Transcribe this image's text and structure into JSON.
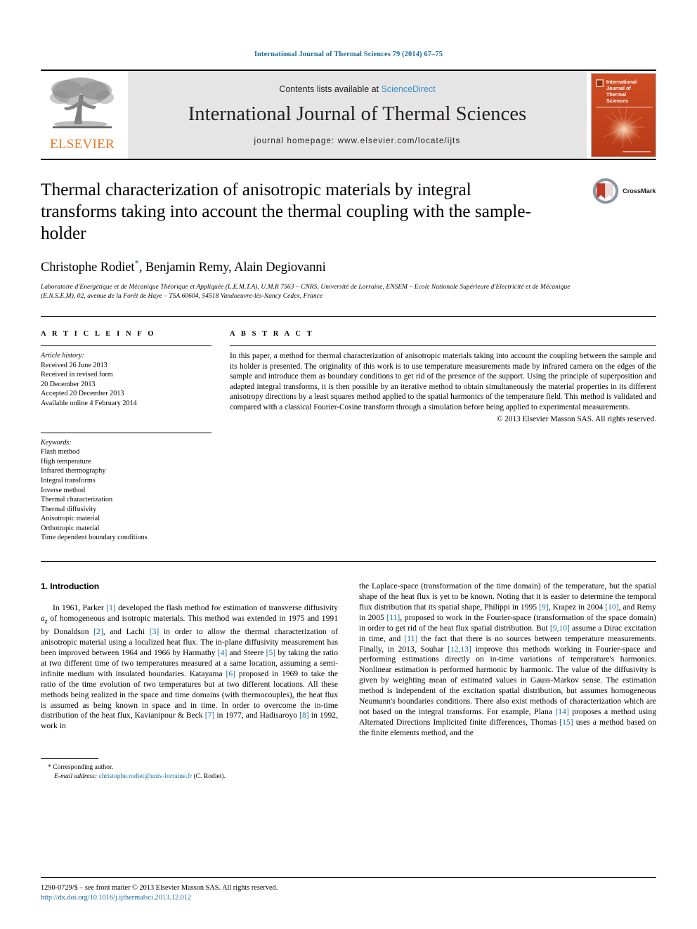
{
  "running_head": "International Journal of Thermal Sciences 79 (2014) 67–75",
  "masthead": {
    "publisher_name": "ELSEVIER",
    "contents_prefix": "Contents lists available at ",
    "sciencedirect": "ScienceDirect",
    "journal_title": "International Journal of Thermal Sciences",
    "homepage": "journal homepage: www.elsevier.com/locate/ijts",
    "cover_title_line1": "International",
    "cover_title_line2": "Journal of",
    "cover_title_line3": "Thermal",
    "cover_title_line4": "Sciences",
    "cover_color": "#c7441f"
  },
  "crossmark": {
    "label": "CrossMark"
  },
  "article": {
    "title": "Thermal characterization of anisotropic materials by integral transforms taking into account the thermal coupling with the sample-holder",
    "authors": "Christophe Rodiet",
    "authors_rest": ", Benjamin Remy, Alain Degiovanni",
    "corresponding_marker": "*",
    "affiliation": "Laboratoire d'Energétique et de Mécanique Théorique et Appliquée (L.E.M.T.A), U.M.R 7563 – CNRS, Université de Lorraine, ENSEM – Ecole Nationale Supérieure d'Electricité et de Mécanique (E.N.S.E.M), 02, avenue de la Forêt de Haye – TSA 60604, 54518 Vandoeuvre-lès-Nancy Cedex, France"
  },
  "article_info": {
    "heading": "A R T I C L E   I N F O",
    "history_label": "Article history:",
    "history": [
      "Received 26 June 2013",
      "Received in revised form",
      "20 December 2013",
      "Accepted 20 December 2013",
      "Available online 4 February 2014"
    ],
    "keywords_label": "Keywords:",
    "keywords": [
      "Flash method",
      "High temperature",
      "Infrared thermography",
      "Integral transforms",
      "Inverse method",
      "Thermal characterization",
      "Thermal diffusivity",
      "Anisotropic material",
      "Orthotropic material",
      "Time dependent boundary conditions"
    ]
  },
  "abstract": {
    "heading": "A B S T R A C T",
    "text": "In this paper, a method for thermal characterization of anisotropic materials taking into account the coupling between the sample and its holder is presented. The originality of this work is to use temperature measurements made by infrared camera on the edges of the sample and introduce them as boundary conditions to get rid of the presence of the support. Using the principle of superposition and adapted integral transforms, it is then possible by an iterative method to obtain simultaneously the material properties in its different anisotropy directions by a least squares method applied to the spatial harmonics of the temperature field. This method is validated and compared with a classical Fourier-Cosine transform through a simulation before being applied to experimental measurements.",
    "copyright": "© 2013 Elsevier Masson SAS. All rights reserved."
  },
  "introduction": {
    "section_number_title": "1.  Introduction",
    "left_parts": {
      "p1_a": "In 1961, Parker ",
      "c1": "[1]",
      "p1_b": " developed the flash method for estimation of transverse diffusivity ",
      "a_z": "a",
      "a_z_sub": "z",
      "p1_c": " of homogeneous and isotropic materials. This method was extended in 1975 and 1991 by Donaldson ",
      "c2": "[2]",
      "p1_d": ", and Lachi ",
      "c3": "[3]",
      "p1_e": " in order to allow the thermal characterization of anisotropic material using a localized heat flux. The in-plane diffusivity measurement has been improved between 1964 and 1966 by Harmathy ",
      "c4": "[4]",
      "p1_f": " and Steere ",
      "c5": "[5]",
      "p1_g": " by taking the ratio at two different time of two temperatures measured at a same location, assuming a semi-infinite medium with insulated boundaries. Katayama ",
      "c6": "[6]",
      "p1_h": " proposed in 1969 to take the ratio of the time evolution of two temperatures but at two different locations. All these methods being realized in the space and time domains (with thermocouples), the heat flux is assumed as being known in space and in time. In order to overcome the in-time distribution of the heat flux, Kavianipour & Beck ",
      "c7": "[7]",
      "p1_i": " in 1977, and Hadisaroyo ",
      "c8": "[8]",
      "p1_j": " in 1992, work in"
    },
    "right_parts": {
      "p2_a": "the Laplace-space (transformation of the time domain) of the temperature, but the spatial shape of the heat flux is yet to be known. Noting that it is easier to determine the temporal flux distribution that its spatial shape, Philippi in 1995 ",
      "c9": "[9]",
      "p2_b": ", Krapez in 2004 ",
      "c10": "[10]",
      "p2_c": ", and Remy in 2005 ",
      "c11": "[11]",
      "p2_d": ", proposed to work in the Fourier-space (transformation of the space domain) in order to get rid of the heat flux spatial distribution. But ",
      "c910": "[9,10]",
      "p2_e": " assume a Dirac excitation in time, and ",
      "c11b": "[11]",
      "p2_f": " the fact that there is no sources between temperature measurements. Finally, in 2013, Souhar ",
      "c1213": "[12,13]",
      "p2_g": " improve this methods working in Fourier-space and performing estimations directly on in-time variations of temperature's harmonics. Nonlinear estimation is performed harmonic by harmonic. The value of the diffusivity is given by weighting mean of estimated values in Gauss-Markov sense. The estimation method is independent of the excitation spatial distribution, but assumes homogeneous Neumann's boundaries conditions. There also exist methods of characterization which are not based on the integral transforms. For example, Plana ",
      "c14": "[14]",
      "p2_h": " proposes a method using Alternated Directions Implicited finite differences, Thomas ",
      "c15": "[15]",
      "p2_i": " uses a method based on the finite elements method, and the"
    }
  },
  "footnote": {
    "corresponding": "* Corresponding author.",
    "email_label": "E-mail address:",
    "email": "christophe.rodiet@univ-lorraine.fr",
    "email_suffix": " (C. Rodiet)."
  },
  "page_footer": {
    "issn_line": "1290-0729/$ – see front matter © 2013 Elsevier Masson SAS. All rights reserved.",
    "doi": "http://dx.doi.org/10.1016/j.ijthermalsci.2013.12.012"
  },
  "colors": {
    "link": "#1a6b9a",
    "elsevier_orange": "#E87722",
    "band_gray": "#e5e5e5"
  }
}
